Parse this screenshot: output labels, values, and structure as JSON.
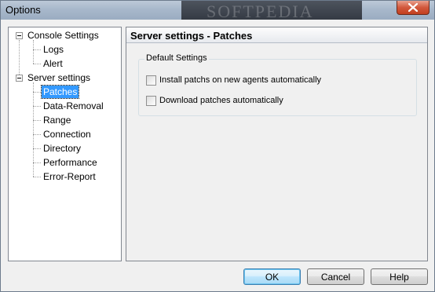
{
  "window": {
    "title": "Options",
    "watermark": "SOFTPEDIA"
  },
  "tree": {
    "items": [
      {
        "label": "Console Settings"
      },
      {
        "label": "Logs"
      },
      {
        "label": "Alert"
      },
      {
        "label": "Server settings"
      },
      {
        "label": "Patches"
      },
      {
        "label": "Data-Removal"
      },
      {
        "label": "Range"
      },
      {
        "label": "Connection"
      },
      {
        "label": "Directory"
      },
      {
        "label": "Performance"
      },
      {
        "label": "Error-Report"
      }
    ],
    "selected": "Patches"
  },
  "content": {
    "header": "Server settings - Patches",
    "group": {
      "legend": "Default Settings",
      "checkboxes": [
        {
          "label": "Install patchs on new agents automatically",
          "checked": false
        },
        {
          "label": "Download patches automatically",
          "checked": false
        }
      ]
    }
  },
  "buttons": {
    "ok": "OK",
    "cancel": "Cancel",
    "help": "Help"
  },
  "colors": {
    "selection": "#3399ff",
    "close_button": "#c23f1f"
  }
}
